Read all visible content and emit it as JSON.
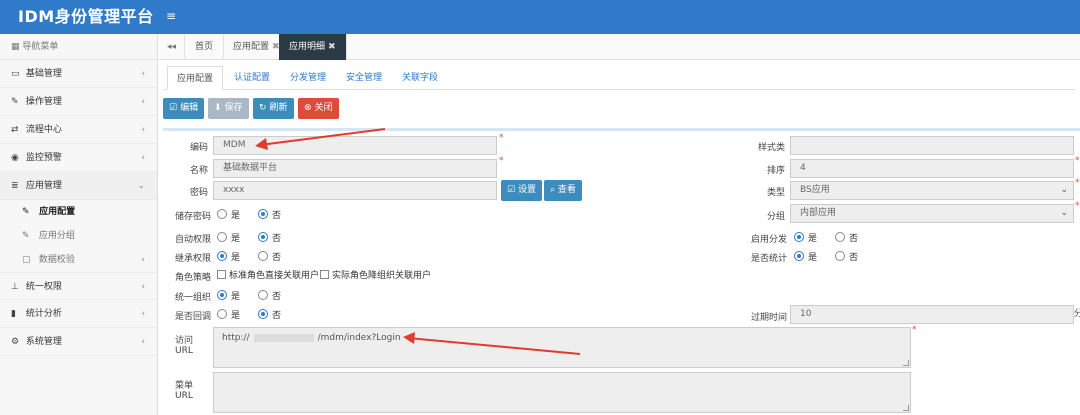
{
  "app": {
    "title": "IDM身份管理平台",
    "menu_toggle": "≡"
  },
  "sidebar": {
    "header": "导航菜单",
    "items": [
      {
        "label": "基础管理",
        "icon": "id-card-icon",
        "glyph": "▭"
      },
      {
        "label": "操作管理",
        "icon": "pencil-icon",
        "glyph": "✎"
      },
      {
        "label": "流程中心",
        "icon": "shuffle-icon",
        "glyph": "⇄"
      },
      {
        "label": "监控预警",
        "icon": "eye-icon",
        "glyph": "◉"
      },
      {
        "label": "应用管理",
        "icon": "list-icon",
        "glyph": "≣"
      }
    ],
    "sub_items": [
      {
        "label": "应用配置",
        "glyph": "✎"
      },
      {
        "label": "应用分组",
        "glyph": "✎"
      },
      {
        "label": "数据校验",
        "glyph": "▢"
      }
    ],
    "items2": [
      {
        "label": "统一权限",
        "icon": "sitemap-icon",
        "glyph": "⊥"
      },
      {
        "label": "统计分析",
        "icon": "bar-chart-icon",
        "glyph": "▮"
      },
      {
        "label": "系统管理",
        "icon": "cogs-icon",
        "glyph": "⚙"
      }
    ],
    "chevron_left": "‹",
    "chevron_down": "⌄"
  },
  "page_tabs": {
    "back": "◂◂",
    "tabs": [
      {
        "label": "首页"
      },
      {
        "label": "应用配置",
        "close": "✖"
      },
      {
        "label": "应用明细",
        "close": "✖"
      }
    ]
  },
  "inner_tabs": [
    "应用配置",
    "认证配置",
    "分发管理",
    "安全管理",
    "关联字段"
  ],
  "toolbar": {
    "edit": "编辑",
    "edit_glyph": "☑",
    "save": "保存",
    "save_glyph": "⬇",
    "refresh": "刷新",
    "refresh_glyph": "↻",
    "close": "关闭",
    "close_glyph": "⊗"
  },
  "form": {
    "code_label": "编码",
    "code_value": "MDM",
    "name_label": "名称",
    "name_value": "基础数据平台",
    "password_label": "密码",
    "password_value": "xxxx",
    "set_btn": "设置",
    "set_glyph": "☑",
    "view_btn": "查看",
    "view_glyph": "⌕",
    "store_pwd_label": "储存密码",
    "auto_perm_label": "自动权限",
    "inherit_perm_label": "继承权限",
    "role_policy_label": "角色策略",
    "role_policy_opt1": "标准角色直接关联用户",
    "role_policy_opt2": "实际角色降组织关联用户",
    "unified_org_label": "统一组织",
    "rollback_label": "是否回调",
    "yes": "是",
    "no": "否",
    "style_label": "样式类",
    "order_label": "排序",
    "order_value": "4",
    "type_label": "类型",
    "type_value": "BS应用",
    "group_label": "分组",
    "group_value": "内部应用",
    "enable_dist_label": "启用分发",
    "is_stat_label": "是否统计",
    "expire_label": "过期时间",
    "expire_value": "10",
    "expire_unit": "分",
    "url_label": "访问URL",
    "url_prefix": "http://",
    "url_suffix": "/mdm/index?Login",
    "menu_url_label": "菜单URL",
    "select_arrow": "⌄",
    "required": "*"
  },
  "colors": {
    "brand": "#2f7ac9",
    "danger": "#dd4b39",
    "button": "#3c8dbc",
    "active_tab": "#2b3a45"
  }
}
